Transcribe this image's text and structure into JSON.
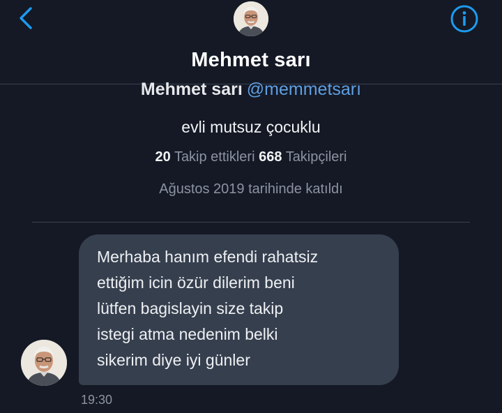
{
  "header": {
    "title": "Mehmet sarı"
  },
  "profile": {
    "name": "Mehmet sarı",
    "handle": "@memmetsarı",
    "bio": "evli mutsuz çocuklu",
    "following_count": "20",
    "following_label": "Takip ettikleri",
    "followers_count": "668",
    "followers_label": "Takipçileri",
    "joined": "Ağustos 2019 tarihinde katıldı"
  },
  "message": {
    "lines": [
      "Merhaba hanım efendi rahatsiz",
      "ettiğim icin özür dilerim beni",
      "lütfen bagislayin size takip",
      "istegi atma nedenim belki",
      "sikerim diye iyi günler"
    ],
    "time": "19:30"
  },
  "colors": {
    "background": "#141925",
    "bubble": "#363f4e",
    "accent": "#1d9bf0",
    "handle": "#5f9fe3",
    "muted_text": "#8c93a1"
  },
  "icons": {
    "back": "chevron-left",
    "info": "info-circle"
  }
}
